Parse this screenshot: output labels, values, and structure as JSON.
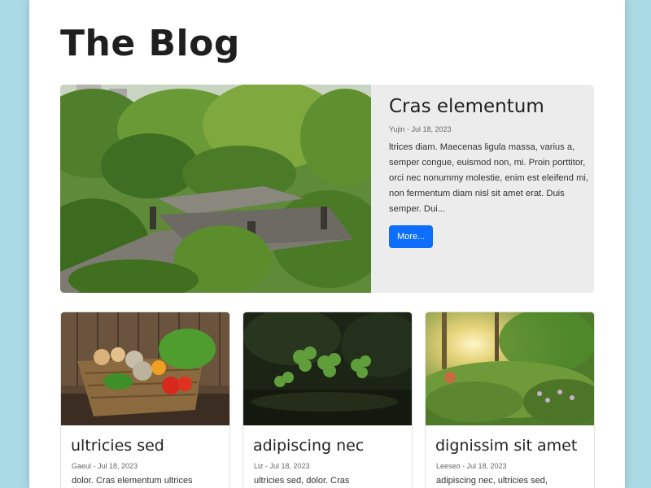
{
  "blog": {
    "title": "The Blog"
  },
  "featured": {
    "title": "Cras elementum",
    "meta": "Yujin - Jul 18, 2023",
    "excerpt": "ltrices diam. Maecenas ligula massa, varius a, semper congue, euismod non, mi. Proin porttitor, orci nec nonummy molestie, enim est eleifend mi, non fermentum diam nisl sit amet erat. Duis semper. Dui...",
    "button_label": "More..."
  },
  "cards": [
    {
      "title": "ultricies sed",
      "meta": "Gaeul - Jul 18, 2023",
      "excerpt": "dolor. Cras elementum ultrices"
    },
    {
      "title": "adipiscing nec",
      "meta": "Liz - Jul 18, 2023",
      "excerpt": "ultricies sed, dolor. Cras"
    },
    {
      "title": "dignissim sit amet",
      "meta": "Leeseo - Jul 18, 2023",
      "excerpt": "adipiscing nec, ultricies sed,"
    }
  ],
  "colors": {
    "accent": "#0d6efd",
    "featured_bg": "#ececec",
    "page_bg": "#ffffff",
    "backdrop": "#a9d9e3"
  }
}
